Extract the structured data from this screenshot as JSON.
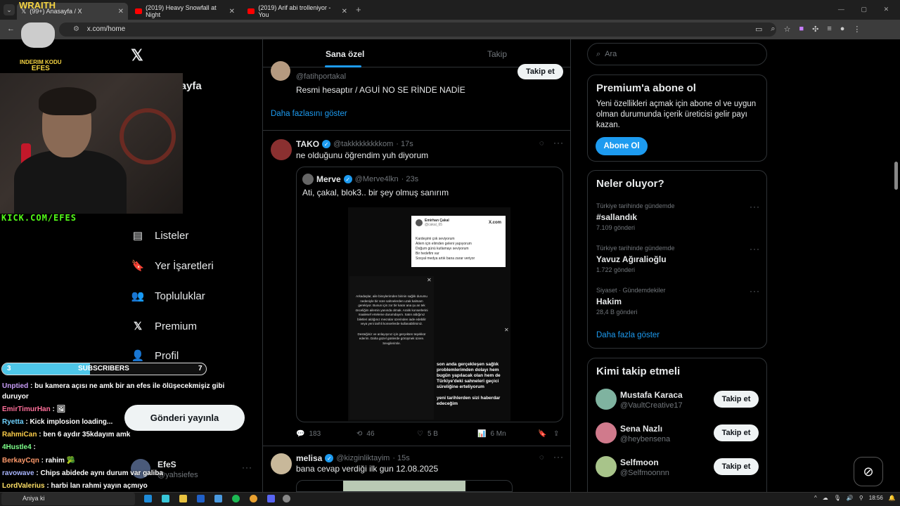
{
  "browser": {
    "tabs": [
      {
        "label": "(99+) Anasayfa / X"
      },
      {
        "label": "(2019) Heavy Snowfall at Night"
      },
      {
        "label": "(2019) Arif abi trolleniyor - You"
      }
    ],
    "new_tab": "+",
    "url": "x.com/home"
  },
  "overlay": {
    "wraith": "WRAITH",
    "brand_line1": "INDERIM KODU",
    "brand_line2": "EFES",
    "kick": "KICK.COM/EFES",
    "subs_current": "3",
    "subs_label": "SUBSCRIBERS",
    "subs_goal": "7",
    "subs_fraction": 0.43
  },
  "chat": [
    {
      "user": "Unptied",
      "text": " : bu kamera açısı ne amk bir an efes ile ölüşecekmişiz gibi",
      "color": "#c89cf7"
    },
    {
      "user": "",
      "text": "duruyor",
      "color": "#ffffff"
    },
    {
      "user": "EmirTimurHan",
      "text": " : 🖼",
      "color": "#ff6f9a"
    },
    {
      "user": "Ryetta",
      "text": " : Kick implosion loading...",
      "color": "#6fd3ff"
    },
    {
      "user": "RahmiCan",
      "text": " : ben 6 aydır 35kdayım amk",
      "color": "#ffcf4a"
    },
    {
      "user": "4Hustle4",
      "text": " : ",
      "color": "#7dff8a"
    },
    {
      "user": "BerkayCqn",
      "text": " : rahim 🥦",
      "color": "#ff9a6b"
    },
    {
      "user": "ravowave",
      "text": " : Chips abidede aynı durum var galiba",
      "color": "#a9b6ff"
    },
    {
      "user": "LordValerius",
      "text": " : harbi lan rahmi yayın açmıyo",
      "color": "#ffe066"
    }
  ],
  "nav": {
    "items": [
      {
        "label": "Anasayfa"
      },
      {
        "label": "Listeler"
      },
      {
        "label": "Yer İşaretleri"
      },
      {
        "label": "Topluluklar"
      },
      {
        "label": "Premium"
      },
      {
        "label": "Profil"
      }
    ],
    "post_button": "Gönderi yayınla",
    "account_name": "EfeS",
    "account_handle": "@yahsiefes"
  },
  "feed": {
    "tabs": [
      {
        "label": "Sana özel"
      },
      {
        "label": "Takip"
      }
    ],
    "suggested": {
      "handle": "@fatihportakal",
      "bio": "Resmi hesaptır / AGUİ NO SE RİNDE NADİE",
      "follow": "Takip et",
      "show_more": "Daha fazlasını göster"
    },
    "tweet1": {
      "name": "TAKO",
      "handle": "@takkkkkkkkkom",
      "time": "· 17s",
      "text": "ne olduğunu öğrendim yuh diyorum",
      "quote": {
        "name": "Merve",
        "handle": "@Merve4lkn",
        "time": "· 23s",
        "text": "Ati, çakal, blok3.. bir şey olmuş sanırım",
        "media": {
          "card_name": "Emirhan Çakal",
          "card_handle": "@cakal_65",
          "card_brand": "X.com",
          "card_lines": [
            "Kardeşimi çok seviyorum",
            "Ailem için elimden geleni yapıyorum",
            "Doğum günü kutlamayı seviyorum",
            "Bir hedefim var",
            "Sosyal medya artık bana zarar veriyor"
          ],
          "story_text": "Arkadaşlar, aile bireylerimden birinin sağlık durumu nedeniyle bir süre sahnelerden uzak kalmam gerekiyor. Bunun için zor bir karar ana şu an tek önceliğim ailemin yanında olmak. Aralık konserlerini maalesef erteleme durumdayım. Satın aldığınız biletleri aldığınız mecralar üzerinden iade edebilir veya yeni tarihli konserlerde kullanabilirsiniz.",
          "story_end": "Desteğiniz ve anlayışınız için gerçekten teşekkür ederim. Daha güzel günlerde görüşmek üzere. Sevgilerimle.",
          "right_text": "son anda gerçekleşen sağlık problemlerimden dolayı hem bugün yapılacak olan hem de Türkiye'deki sahneleri geçici süreliğine erteliyorum",
          "right_text2": "yeni tarihlerden sizi haberdar edeceğim"
        }
      },
      "replies": "183",
      "retweets": "46",
      "likes": "5 B",
      "views": "6 Mn"
    },
    "tweet2": {
      "name": "melisa",
      "handle": "@kizginliktayim",
      "time": "· 15s",
      "text": "bana cevap verdiği ilk gun 12.08.2025"
    }
  },
  "right": {
    "search_placeholder": "Ara",
    "premium": {
      "title": "Premium'a abone ol",
      "body": "Yeni özellikleri açmak için abone ol ve uygun olman durumunda içerik üreticisi gelir payı kazan.",
      "button": "Abone Ol"
    },
    "trends": {
      "title": "Neler oluyor?",
      "items": [
        {
          "meta": "Türkiye tarihinde gündemde",
          "name": "#sallandık",
          "count": "7.109 gönderi"
        },
        {
          "meta": "Türkiye tarihinde gündemde",
          "name": "Yavuz Ağıralioğlu",
          "count": "1.722 gönderi"
        },
        {
          "meta": "Siyaset · Gündemdekiler",
          "name": "Hakim",
          "count": "28,4 B gönderi"
        }
      ],
      "more": "Daha fazla göster"
    },
    "who": {
      "title": "Kimi takip etmeli",
      "items": [
        {
          "name": "Mustafa Karaca",
          "handle": "@VaultCreative17",
          "button": "Takip et"
        },
        {
          "name": "Sena Nazlı",
          "handle": "@heybensena",
          "button": "Takip et"
        },
        {
          "name": "Selfmoon",
          "handle": "@Selfmoonnn",
          "button": "Takip et"
        }
      ]
    }
  },
  "taskbar": {
    "search_text": "Aniya ki",
    "clock": "18:56"
  }
}
